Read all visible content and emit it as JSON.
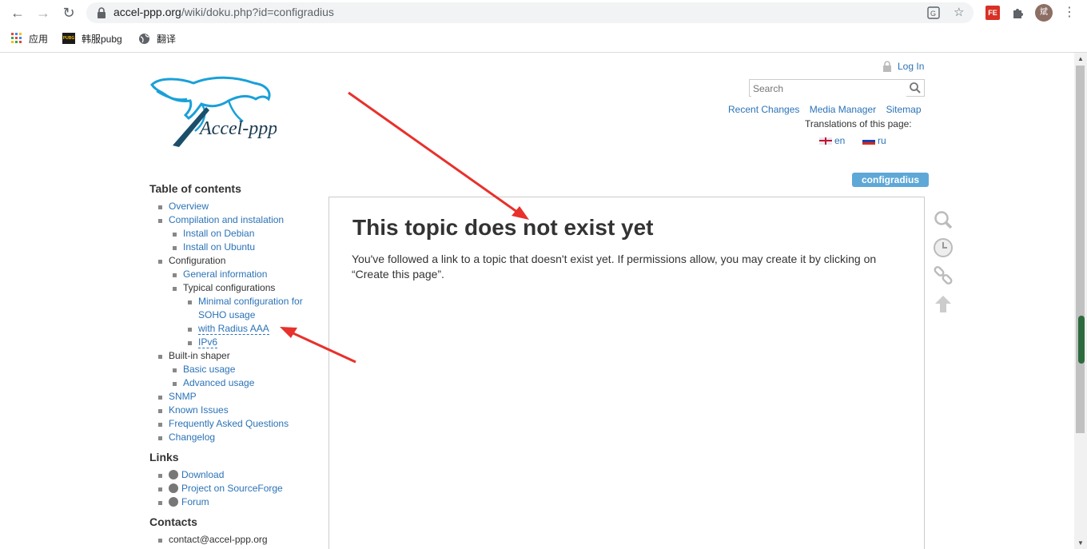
{
  "browser": {
    "url_host": "accel-ppp.org",
    "url_path": "/wiki/doku.php?id=configradius",
    "avatar_text": "斌",
    "ext_label": "FE",
    "bookmarks": [
      {
        "label": "应用",
        "icon": "apps-grid-icon"
      },
      {
        "label": "韩服pubg",
        "icon": "pubg-icon",
        "icon_text": "PUBG"
      },
      {
        "label": "翻译",
        "icon": "globe-icon"
      }
    ]
  },
  "header": {
    "login_label": "Log In",
    "search_placeholder": "Search",
    "links": [
      "Recent Changes",
      "Media Manager",
      "Sitemap"
    ],
    "translations_label": "Translations of this page:",
    "languages": [
      {
        "code": "en",
        "label": "en"
      },
      {
        "code": "ru",
        "label": "ru"
      }
    ],
    "logo_text": "Accel-ppp"
  },
  "page_id": "configradius",
  "content": {
    "title": "This topic does not exist yet",
    "body": "You've followed a link to a topic that doesn't exist yet. If permissions allow, you may create it by clicking on “Create this page”."
  },
  "sidebar": {
    "toc_heading": "Table of contents",
    "toc": [
      {
        "label": "Overview",
        "level": 1,
        "link": true
      },
      {
        "label": "Compilation and instalation",
        "level": 1,
        "link": true
      },
      {
        "label": "Install on Debian",
        "level": 2,
        "link": true
      },
      {
        "label": "Install on Ubuntu",
        "level": 2,
        "link": true
      },
      {
        "label": "Configuration",
        "level": 1,
        "link": false
      },
      {
        "label": "General information",
        "level": 2,
        "link": true
      },
      {
        "label": "Typical configurations",
        "level": 2,
        "link": false
      },
      {
        "label": "Minimal configuration for SOHO usage",
        "level": 3,
        "link": true
      },
      {
        "label": "with Radius AAA",
        "level": 3,
        "link": true
      },
      {
        "label": "IPv6",
        "level": 3,
        "link": true
      },
      {
        "label": "Built-in shaper",
        "level": 1,
        "link": false
      },
      {
        "label": "Basic usage",
        "level": 2,
        "link": true
      },
      {
        "label": "Advanced usage",
        "level": 2,
        "link": true
      },
      {
        "label": "SNMP",
        "level": 1,
        "link": true
      },
      {
        "label": "Known Issues",
        "level": 1,
        "link": true
      },
      {
        "label": "Frequently Asked Questions",
        "level": 1,
        "link": true
      },
      {
        "label": "Changelog",
        "level": 1,
        "link": true
      }
    ],
    "links_heading": "Links",
    "links": [
      "Download",
      "Project on SourceForge",
      "Forum"
    ],
    "contacts_heading": "Contacts",
    "contacts": [
      "contact@accel-ppp.org"
    ]
  },
  "colors": {
    "link": "#2b73b7",
    "page_id_badge": "#5ea8d7",
    "annotation_arrow": "#e8312b",
    "logo": "#1aa0d8"
  }
}
